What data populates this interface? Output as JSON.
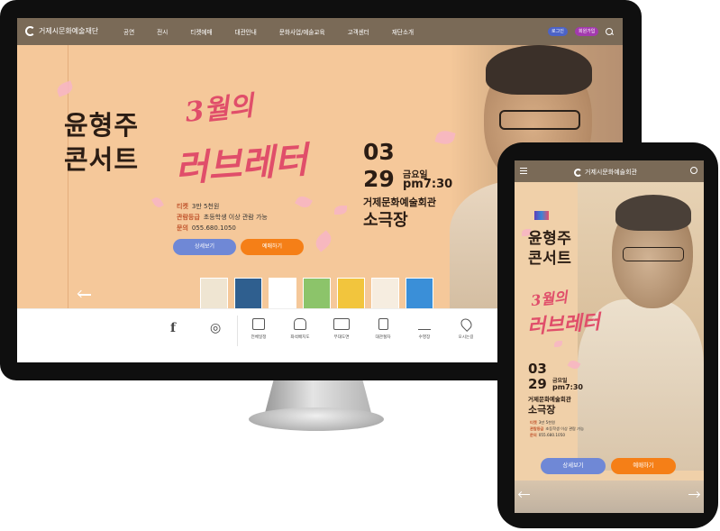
{
  "brand": {
    "name": "거제시문화예술재단",
    "header_color": "#7a6a57"
  },
  "desktop": {
    "nav": [
      "공연",
      "전시",
      "티켓예매",
      "대관안내",
      "문화사업/예술교육",
      "고객센터",
      "재단소개"
    ],
    "login_label": "로그인",
    "join_label": "회원가입",
    "icons": {
      "search": "search-icon"
    },
    "hero": {
      "title_line1": "윤형주",
      "title_line2": "콘서트",
      "script_line1": "3월의",
      "script_line2": "러브레터",
      "date_month": "03",
      "date_day": "29",
      "weekday": "금요일",
      "time": "pm7:30",
      "venue": "거제문화예술회관",
      "hall": "소극장",
      "info": [
        {
          "label": "티켓",
          "value": "3만 5천원"
        },
        {
          "label": "관람등급",
          "value": "초등학생 이상 관람 가능"
        },
        {
          "label": "문의",
          "value": "055.680.1050"
        }
      ],
      "detail_button": "상세보기",
      "book_button": "예매하기",
      "thumbnails": [
        {
          "name": "윤형주 콘서트",
          "color": "#efe5d2"
        },
        {
          "name": "poster-2",
          "color": "#2f5f8f"
        },
        {
          "name": "poster-3",
          "color": "#ffffff"
        },
        {
          "name": "poster-4",
          "color": "#8cc46a"
        },
        {
          "name": "poster-5",
          "color": "#f2c53d"
        },
        {
          "name": "poster-6",
          "color": "#f6ede0"
        },
        {
          "name": "poster-7",
          "color": "#3a8fd8"
        }
      ],
      "background": "#f5c89a",
      "accent_pink": "#e04e6a",
      "button_blue": "#6f88d6",
      "button_orange": "#f57f17"
    },
    "quick_menu": {
      "sns": [
        {
          "icon": "facebook-icon",
          "glyph": "f"
        },
        {
          "icon": "instagram-icon",
          "glyph": "◎"
        }
      ],
      "items": [
        {
          "label": "전체일정",
          "icon": "calendar-icon"
        },
        {
          "label": "좌석배치도",
          "icon": "seat-icon"
        },
        {
          "label": "무대도면",
          "icon": "stage-icon"
        },
        {
          "label": "대관절차",
          "icon": "document-icon"
        },
        {
          "label": "수영장",
          "icon": "pool-icon"
        },
        {
          "label": "오시는길",
          "icon": "location-icon"
        }
      ]
    }
  },
  "mobile": {
    "logo": "거제시문화예술회관",
    "icons": {
      "menu": "menu-icon",
      "search": "search-icon"
    },
    "hero": {
      "title_line1": "윤형주",
      "title_line2": "콘서트",
      "script_line1": "3월의",
      "script_line2": "러브레터",
      "date_month": "03",
      "date_day": "29",
      "weekday": "금요일",
      "time": "pm7:30",
      "venue": "거제문화예술회관",
      "hall": "소극장",
      "info": [
        {
          "label": "티켓",
          "value": "3만 5천원"
        },
        {
          "label": "관람등급",
          "value": "초등학생 이상 관람 가능"
        },
        {
          "label": "문의",
          "value": "055.680.1050"
        }
      ],
      "detail_button": "상세보기",
      "book_button": "예매하기"
    }
  }
}
